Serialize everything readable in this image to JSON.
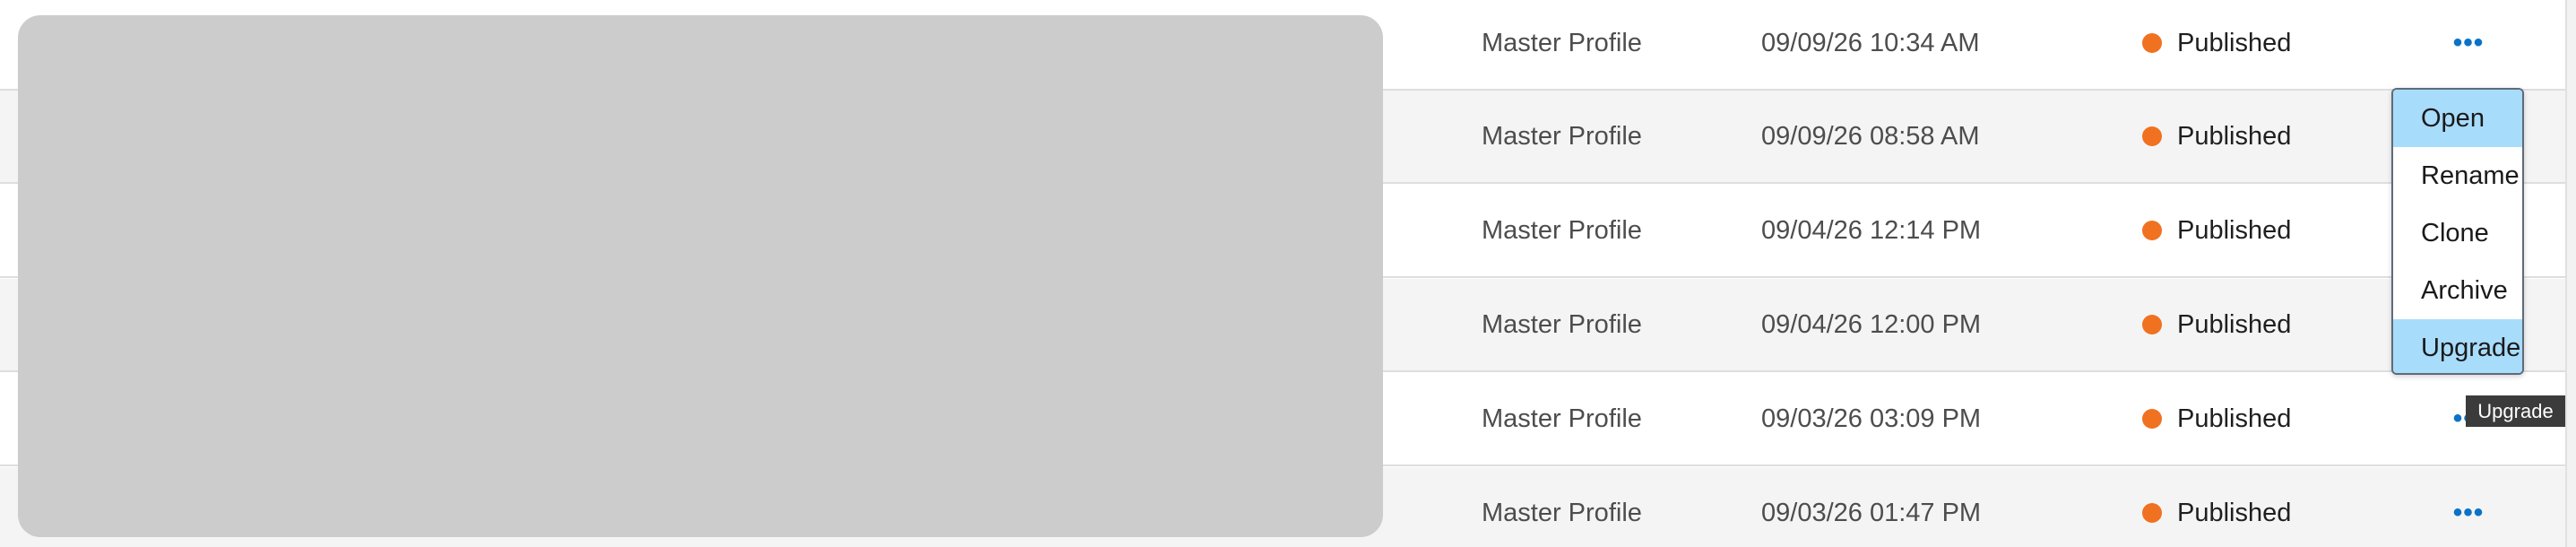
{
  "table": {
    "rows": [
      {
        "profile": "Master Profile",
        "date": "09/09/26 10:34 AM",
        "status": "Published"
      },
      {
        "profile": "Master Profile",
        "date": "09/09/26 08:58 AM",
        "status": "Published"
      },
      {
        "profile": "Master Profile",
        "date": "09/04/26 12:14 PM",
        "status": "Published"
      },
      {
        "profile": "Master Profile",
        "date": "09/04/26 12:00 PM",
        "status": "Published"
      },
      {
        "profile": "Master Profile",
        "date": "09/03/26 03:09 PM",
        "status": "Published"
      },
      {
        "profile": "Master Profile",
        "date": "09/03/26 01:47 PM",
        "status": "Published"
      }
    ],
    "actions_glyph": "•••"
  },
  "menu": {
    "items": [
      "Open",
      "Rename",
      "Clone",
      "Archive",
      "Upgrade"
    ]
  },
  "tooltip": {
    "text": "Upgrade"
  },
  "colors": {
    "status_published": "#f07120",
    "actions_link": "#0b72c8",
    "menu_highlight": "#a8dcfb",
    "redaction": "#cccccc"
  }
}
